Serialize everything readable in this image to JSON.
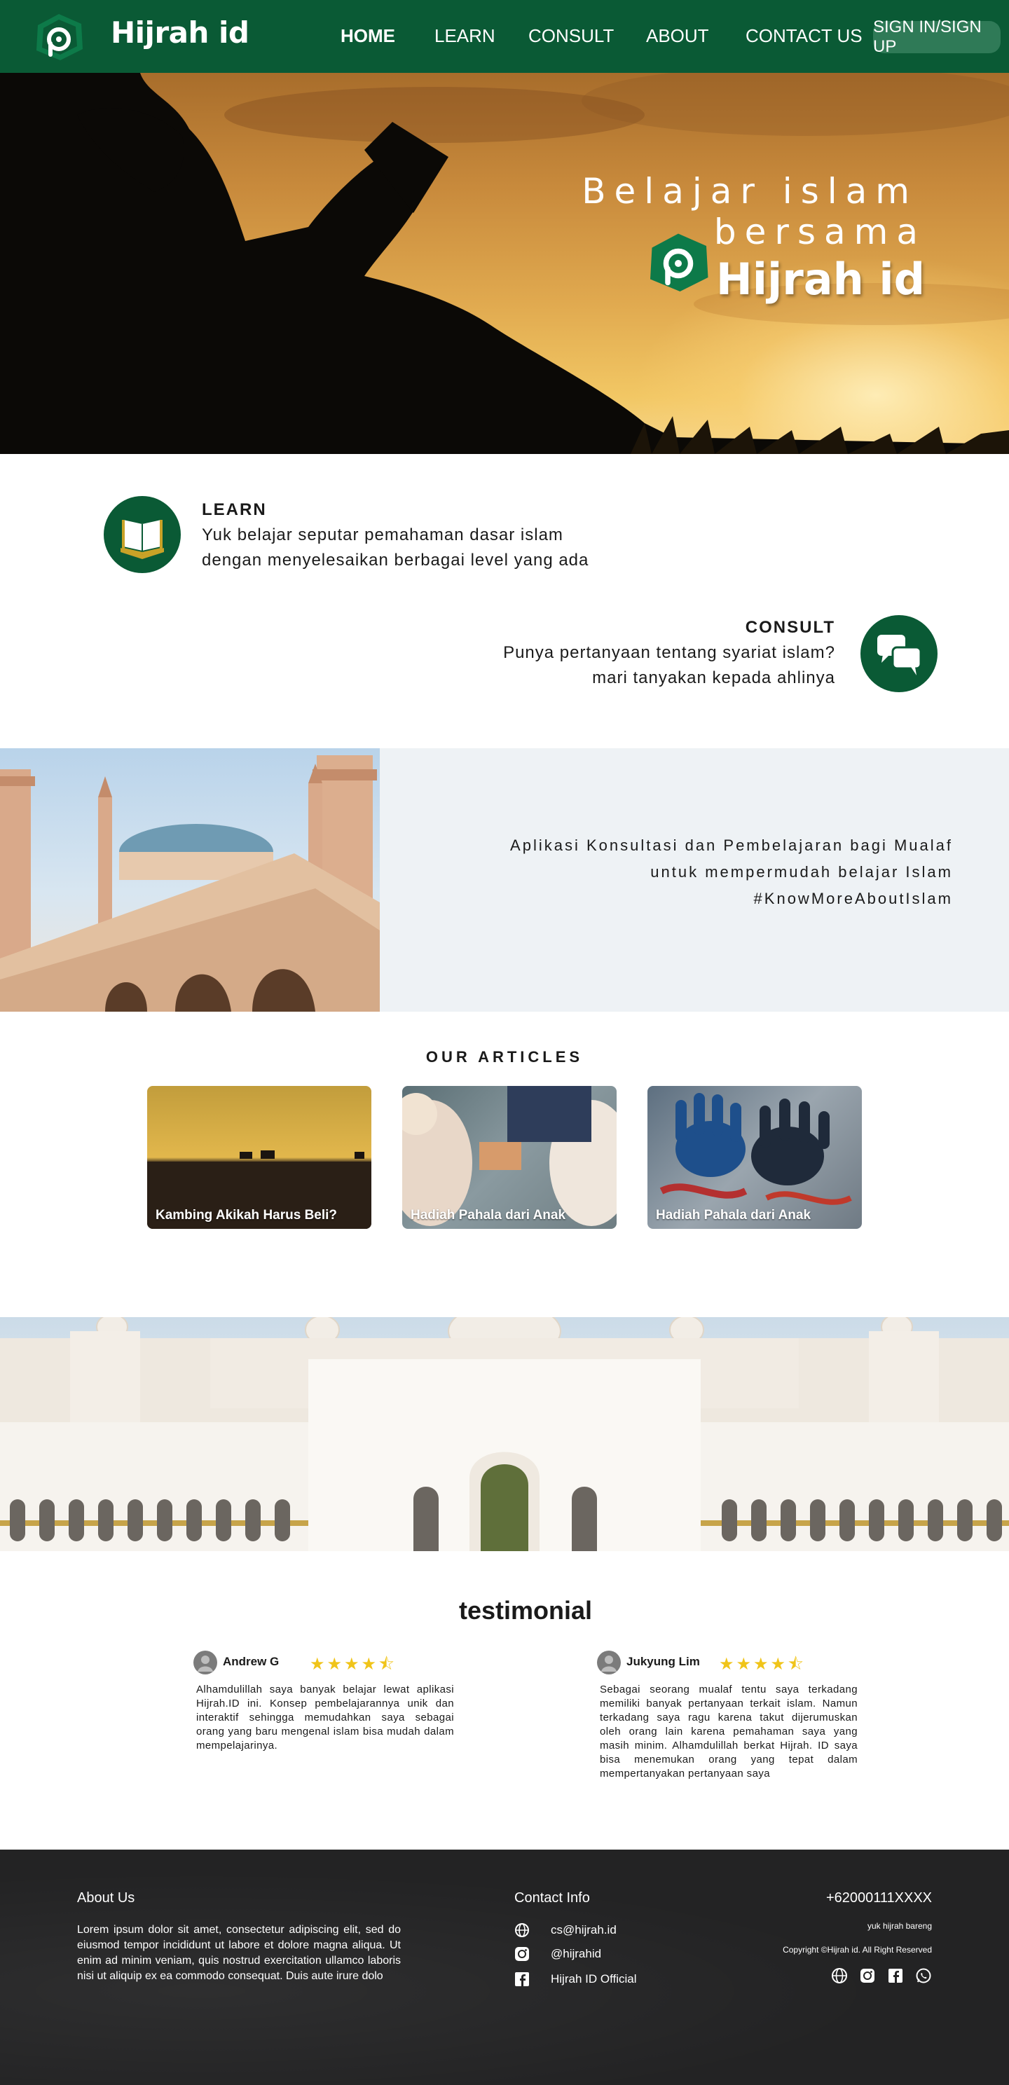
{
  "nav": {
    "brand": "Hijrah id",
    "items": [
      "HOME",
      "LEARN",
      "CONSULT",
      "ABOUT",
      "CONTACT US"
    ],
    "signin": "SIGN IN/SIGN UP"
  },
  "hero": {
    "line1": "Belajar islam",
    "line2": "bersama",
    "line3": "Hijrah id"
  },
  "learn": {
    "heading": "LEARN",
    "line1": "Yuk belajar seputar pemahaman dasar islam",
    "line2": "dengan menyelesaikan berbagai level yang ada"
  },
  "consult": {
    "heading": "CONSULT",
    "line1": "Punya pertanyaan tentang syariat islam?",
    "line2": "mari tanyakan kepada ahlinya"
  },
  "band": {
    "line1": "Aplikasi Konsultasi dan Pembelajaran bagi Mualaf",
    "line2": "untuk mempermudah belajar Islam",
    "line3": "#KnowMoreAboutIslam"
  },
  "articles": {
    "title": "OUR ARTICLES",
    "cards": [
      {
        "caption": "Kambing Akikah Harus Beli?"
      },
      {
        "caption": "Hadiah Pahala dari Anak"
      },
      {
        "caption": "Hadiah Pahala dari Anak"
      }
    ]
  },
  "testimonial": {
    "title": "testimonial",
    "items": [
      {
        "name": "Andrew  G",
        "rating": 4.5,
        "stars": "★★★★⯪",
        "text": "Alhamdulillah saya banyak belajar lewat aplikasi Hijrah.ID ini. Konsep pembelajarannya unik dan interaktif sehingga memudahkan saya sebagai orang yang baru mengenal islam bisa mudah dalam mempelajarinya."
      },
      {
        "name": "Jukyung Lim",
        "rating": 4.5,
        "stars": "★★★★⯪",
        "text": "Sebagai seorang mualaf tentu saya terkadang memiliki banyak pertanyaan terkait islam. Namun terkadang saya ragu karena takut dijerumuskan oleh orang lain karena pemahaman saya yang masih minim. Alhamdulillah berkat Hijrah. ID saya bisa menemukan orang yang tepat dalam mempertanyakan pertanyaan saya"
      }
    ]
  },
  "footer": {
    "about_heading": "About Us",
    "about_text": "Lorem ipsum dolor sit amet, consectetur adipiscing elit, sed do eiusmod tempor incididunt ut labore et dolore magna aliqua. Ut enim ad minim veniam, quis nostrud exercitation ullamco laboris nisi ut aliquip ex ea commodo consequat. Duis aute irure dolo",
    "contact_heading": "Contact Info",
    "email": "cs@hijrah.id",
    "instagram": "@hijrahid",
    "facebook": "Hijrah ID Official",
    "phone": "+62000111XXXX",
    "tagline": "yuk hijrah bareng",
    "copyright": "Copyright ©Hijrah id. All Right Reserved"
  },
  "colors": {
    "brand_green": "#0a5a35",
    "footer_bg": "#232324",
    "star": "#f0c419"
  },
  "icons": [
    "logo-icon",
    "quran-book-icon",
    "chat-bubbles-icon",
    "globe-icon",
    "instagram-icon",
    "facebook-icon",
    "whatsapp-icon",
    "user-avatar-icon",
    "star-icon"
  ]
}
